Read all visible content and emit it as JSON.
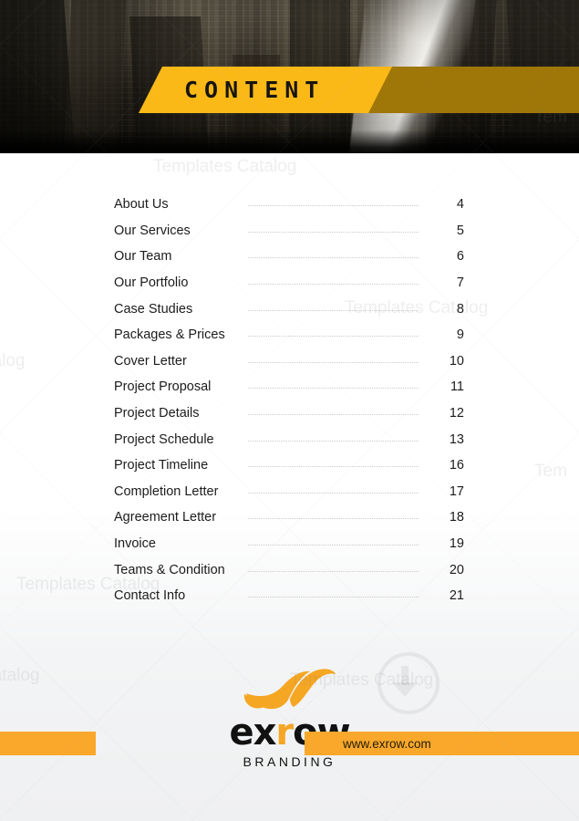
{
  "document": {
    "banner_title": "CONTENT"
  },
  "hero": {
    "image_alt": "city-skyscrapers-photo"
  },
  "toc": {
    "entries": [
      {
        "label": "About Us",
        "page": "4"
      },
      {
        "label": "Our Services",
        "page": "5"
      },
      {
        "label": "Our Team",
        "page": "6"
      },
      {
        "label": "Our Portfolio",
        "page": "7"
      },
      {
        "label": "Case Studies",
        "page": "8"
      },
      {
        "label": "Packages & Prices",
        "page": "9"
      },
      {
        "label": "Cover Letter",
        "page": "10"
      },
      {
        "label": "Project Proposal",
        "page": "11"
      },
      {
        "label": "Project Details",
        "page": "12"
      },
      {
        "label": "Project Schedule",
        "page": "13"
      },
      {
        "label": "Project Timeline",
        "page": "16"
      },
      {
        "label": "Completion Letter",
        "page": "17"
      },
      {
        "label": "Agreement Letter",
        "page": "18"
      },
      {
        "label": "Invoice",
        "page": "19"
      },
      {
        "label": "Teams & Condition",
        "page": "20"
      },
      {
        "label": "Contact Info",
        "page": "21"
      }
    ]
  },
  "logo": {
    "word_part1": "ex",
    "word_r": "r",
    "word_part2": "ow",
    "tagline": "BRANDING"
  },
  "footer": {
    "website": "www.exrow.com"
  },
  "watermarks": {
    "text": "Templates Catalog",
    "short": "Catalog",
    "tiny": "Tem",
    "icon": "download-icon"
  },
  "colors": {
    "banner_bright": "#FBB918",
    "banner_dark": "#9E7708",
    "footer_bar": "#F9A82B",
    "logo_accent": "#F5A623",
    "text_dark": "#1C1C1C"
  }
}
